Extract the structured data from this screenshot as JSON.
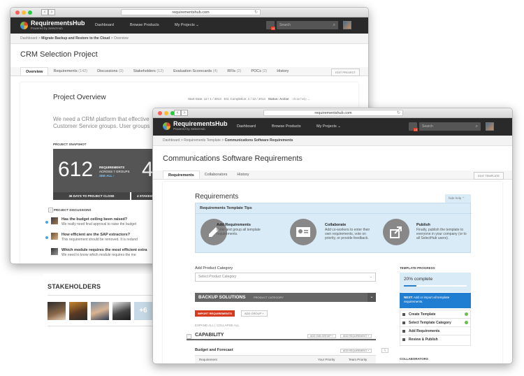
{
  "back_window": {
    "url": "requirementshub.com",
    "nav": {
      "dashboard": "Dashboard",
      "browse": "Browse Products",
      "projects": "My Projects"
    },
    "logo": {
      "title": "RequirementsHub",
      "sub": "Powered by SelectHub"
    },
    "bell_count": "10",
    "search_placeholder": "Search",
    "breadcrumb": {
      "a": "Dashboard",
      "b": "Migrate Backup and Restore to the Cloud",
      "c": "Overview"
    },
    "title": "CRM Selection Project",
    "tabs": [
      {
        "label": "Overview",
        "count": ""
      },
      {
        "label": "Requirements",
        "count": "(142)"
      },
      {
        "label": "Discussions",
        "count": "(3)"
      },
      {
        "label": "Stakeholders",
        "count": "(12)"
      },
      {
        "label": "Evaluation Scorecards",
        "count": "(4)"
      },
      {
        "label": "RFIs",
        "count": "(2)"
      },
      {
        "label": "POCs",
        "count": "(2)"
      },
      {
        "label": "History",
        "count": ""
      }
    ],
    "edit_project": "EDIT PROJECT",
    "overview": {
      "heading": "Project Overview",
      "start": "Start Date: 12 / 1 / 2013",
      "completion": "Est. Completion: 1 / 12 / 2014",
      "status": "Status: Active",
      "show_help": "show help",
      "description": "We need a CRM platform that effective Customer Service groups.  User groups",
      "snapshot_label": "PROJECT SNAPSHOT",
      "req_number": "612",
      "req_label": "REQUIREMENTS",
      "req_sub": "ACROSS 7 GROUPS",
      "see_all": "SEE ALL",
      "second_number": "4",
      "days_label": "36 DAYS TO PROJECT CLOSE",
      "stake_label": "4 STAKEH",
      "discussions_label": "PROJECT DISCUSSIONS",
      "discussions": [
        {
          "title": "Has the budget ceiling been raised?",
          "body": "We really need final approval to raise the budget"
        },
        {
          "title": "How efficient are the SAP extractors?",
          "body": "This requirement should be removed. It is redund"
        },
        {
          "title": "Which module requires the most efficient extra",
          "body": "We need to know which module requires the me"
        }
      ]
    }
  },
  "stakeholders": {
    "title": "STAKEHOLDERS",
    "more": "+6",
    "add": "+"
  },
  "front_window": {
    "url": "requirementshub.com",
    "nav": {
      "dashboard": "Dashboard",
      "browse": "Browse Products",
      "projects": "My Projects"
    },
    "logo": {
      "title": "RequirementsHub",
      "sub": "Powered by SelectHub"
    },
    "bell_count": "10",
    "search_placeholder": "Search",
    "breadcrumb": {
      "a": "Dashboard",
      "b": "Requirements Template",
      "c": "Communications Software Requirements"
    },
    "title": "Communications Software Requirements",
    "tabs": [
      "Requirements",
      "Collaborators",
      "History"
    ],
    "edit_template": "EDIT TEMPLATE",
    "heading": "Requirements",
    "hide_help": "hide help",
    "tips_title": "Requirements Template Tips",
    "tips": [
      {
        "title": "Add Requirements",
        "text": "Enter and group all template requirements."
      },
      {
        "title": "Collaborate",
        "text": "Add co-workers to enter their own requirements, vote on priority, or provide feedback."
      },
      {
        "title": "Publish",
        "text": "Finally, publish the template to everyone in your company (or to all SelectHub users)."
      }
    ],
    "add_category_label": "Add Product Category",
    "select_placeholder": "Select Product Category",
    "category": {
      "name": "BACKUP SOLUTIONS",
      "type": "PRODUCT CATEGORY"
    },
    "import_btn": "IMPORT REQUIREMENTS",
    "add_group_btn": "ADD GROUP",
    "expand": "EXPAND ALL",
    "collapse": "COLLAPSE ALL",
    "capability": "CAPABILITY",
    "add_subgroup": "ADD SUB-GROUP",
    "add_requirement": "ADD REQUIREMENT",
    "budget": "Budget and Forecast",
    "col_req": "Requirement",
    "col_priority": "Your Priority",
    "col_team": "Team Priority",
    "progress_label": "TEMPLATE PROGRESS",
    "progress_text": "20% complete",
    "progress_value": 0.2,
    "next_label": "NEXT:",
    "next_text": "Add or import all template requirements.",
    "steps": [
      "Create Template",
      "Select Template Category",
      "Add Requirements",
      "Review & Publish"
    ],
    "collaborators_label": "COLLABORATORS"
  }
}
